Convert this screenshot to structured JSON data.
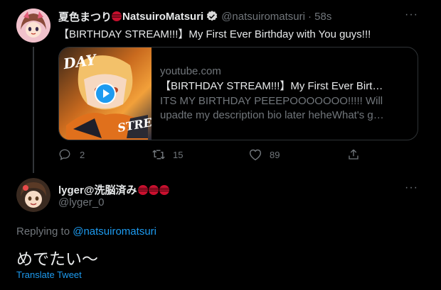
{
  "tweet": {
    "author_name": "夏色まつり",
    "author_name_suffix": "NatsuiroMatsuri",
    "handle": "@natsuiromatsuri",
    "time": "· 58s",
    "text": "【BIRTHDAY STREAM!!!】My First Ever Birthday with You guys!!!",
    "card": {
      "domain": "youtube.com",
      "title": "【BIRTHDAY STREAM!!!】My First Ever Birthday ...",
      "description_line1": "ITS MY BIRTHDAY PEEEPOOOOOOO!!!!! Will",
      "description_line2": "upadte my description bio later heheWhat's good ...",
      "thumb_text_1": "DAY",
      "thumb_text_2": "STRE"
    },
    "replies": "2",
    "retweets": "15",
    "likes": "89"
  },
  "reply": {
    "author_name": "lyger@洗脳済み",
    "handle": "@lyger_0",
    "replying_to_label": "Replying to",
    "replying_to_handle": "@natsuiromatsuri",
    "text": "めでたい〜",
    "translate_label": "Translate Tweet"
  },
  "colors": {
    "background": "#000000",
    "text": "#e7e9ea",
    "muted": "#71767b",
    "link": "#1d9bf0",
    "border": "#2f3336"
  }
}
